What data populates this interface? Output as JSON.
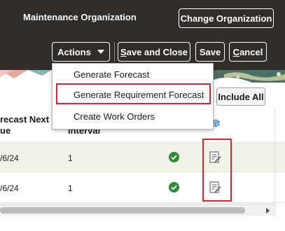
{
  "header": {
    "org_label": "Maintenance Organization",
    "change_org_button": "Change Organization"
  },
  "toolbar": {
    "actions_label": "Actions",
    "save_and_close_label": "ave and Close",
    "save_and_close_mnemonic": "S",
    "save_label": "Save",
    "cancel_label": "ancel",
    "cancel_mnemonic": "C"
  },
  "actions_menu": {
    "items": [
      {
        "label": "Generate Forecast"
      },
      {
        "label": "Generate Requirement Forecast"
      },
      {
        "label": "Create Work Orders"
      }
    ]
  },
  "table": {
    "include_all_button": "Include All",
    "columns": {
      "forecast_next": "recast Next\nue",
      "interval": "Interval"
    },
    "rows": [
      {
        "date": "/6/24",
        "interval": "1",
        "status_icon": "check-circle-icon",
        "action_icon": "edit-icon"
      },
      {
        "date": "/6/24",
        "interval": "1",
        "status_icon": "check-circle-icon",
        "action_icon": "edit-icon"
      }
    ]
  },
  "colors": {
    "header_bg": "#312d2a",
    "highlight_red": "#d9262c",
    "selected_row_bg": "#f1f3e6",
    "check_green": "#2e8b3a"
  }
}
